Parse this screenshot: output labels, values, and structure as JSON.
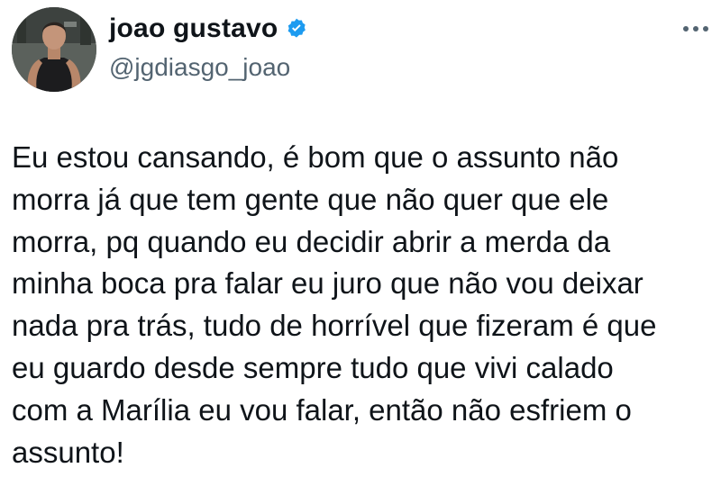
{
  "author": {
    "display_name": "joao gustavo",
    "handle": "@jgdiasgo_joao",
    "verified_icon": "verified-badge-icon",
    "avatar": "profile-photo"
  },
  "colors": {
    "verified_badge": "#1d9bf0",
    "text_primary": "#0f1419",
    "text_secondary": "#536471"
  },
  "tweet": {
    "text": "Eu estou cansando, é bom que o assunto não\nmorra já que tem gente que não quer que ele\nmorra, pq quando eu decidir abrir a merda da\nminha boca pra falar eu juro que não vou deixar\nnada pra trás, tudo de horrível que fizeram é que\neu guardo desde sempre tudo que vivi calado\ncom a Marília eu vou falar, então não esfriem o\nassunto!"
  },
  "actions": {
    "more_icon": "more-options-icon"
  }
}
